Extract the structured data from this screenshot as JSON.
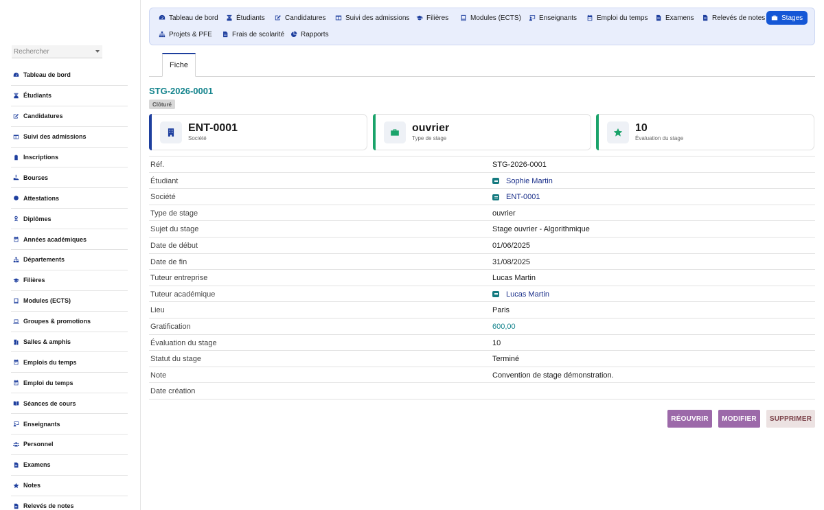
{
  "search": {
    "placeholder": "Rechercher"
  },
  "sidebar": {
    "items": [
      {
        "label": "Tableau de bord",
        "icon": "dashboard-icon"
      },
      {
        "label": "Étudiants",
        "icon": "student-icon"
      },
      {
        "label": "Candidatures",
        "icon": "pen-icon"
      },
      {
        "label": "Suivi des admissions",
        "icon": "columns-icon"
      },
      {
        "label": "Inscriptions",
        "icon": "clipboard-icon"
      },
      {
        "label": "Bourses",
        "icon": "hand-coin-icon"
      },
      {
        "label": "Attestations",
        "icon": "certificate-icon"
      },
      {
        "label": "Diplômes",
        "icon": "award-icon"
      },
      {
        "label": "Années académiques",
        "icon": "calendar-icon"
      },
      {
        "label": "Départements",
        "icon": "sitemap-icon"
      },
      {
        "label": "Filières",
        "icon": "graduation-cap-icon"
      },
      {
        "label": "Modules (ECTS)",
        "icon": "book-icon"
      },
      {
        "label": "Groupes & promotions",
        "icon": "laptop-icon"
      },
      {
        "label": "Salles & amphis",
        "icon": "door-icon"
      },
      {
        "label": "Emplois du temps",
        "icon": "calendar-icon"
      },
      {
        "label": "Emploi du temps",
        "icon": "calendar-icon"
      },
      {
        "label": "Séances de cours",
        "icon": "open-book-icon"
      },
      {
        "label": "Enseignants",
        "icon": "teacher-icon"
      },
      {
        "label": "Personnel",
        "icon": "users-icon"
      },
      {
        "label": "Examens",
        "icon": "file-icon"
      },
      {
        "label": "Notes",
        "icon": "star-icon"
      },
      {
        "label": "Relevés de notes",
        "icon": "file-icon"
      }
    ]
  },
  "topnav": {
    "items": [
      {
        "label": "Tableau de bord",
        "icon": "dashboard-icon"
      },
      {
        "label": "Étudiants",
        "icon": "student-icon"
      },
      {
        "label": "Candidatures",
        "icon": "pen-icon"
      },
      {
        "label": "Suivi des admissions",
        "icon": "columns-icon"
      },
      {
        "label": "Filières",
        "icon": "graduation-cap-icon"
      },
      {
        "label": "Modules (ECTS)",
        "icon": "book-icon"
      },
      {
        "label": "Enseignants",
        "icon": "teacher-icon"
      },
      {
        "label": "Emploi du temps",
        "icon": "calendar-icon"
      },
      {
        "label": "Examens",
        "icon": "file-icon"
      },
      {
        "label": "Relevés de notes",
        "icon": "file-icon"
      },
      {
        "label": "Stages",
        "icon": "briefcase-icon",
        "active": true
      },
      {
        "label": "Projets & PFE",
        "icon": "sitemap-icon"
      },
      {
        "label": "Frais de scolarité",
        "icon": "file-icon"
      },
      {
        "label": "Rapports",
        "icon": "pie-chart-icon"
      }
    ]
  },
  "tabs": {
    "fiche": "Fiche"
  },
  "record": {
    "id": "STG-2026-0001",
    "status": "Clôturé"
  },
  "cards": [
    {
      "value": "ENT-0001",
      "label": "Société",
      "icon": "building-icon",
      "accent": "#1e3f9e"
    },
    {
      "value": "ouvrier",
      "label": "Type de stage",
      "icon": "briefcase-icon",
      "accent": "#1aa36a"
    },
    {
      "value": "10",
      "label": "Évaluation du stage",
      "icon": "star-icon",
      "accent": "#1aa36a"
    }
  ],
  "details": [
    {
      "key": "Réf.",
      "value": "STG-2026-0001"
    },
    {
      "key": "Étudiant",
      "value": "Sophie Martin",
      "link": true
    },
    {
      "key": "Société",
      "value": "ENT-0001",
      "link": true
    },
    {
      "key": "Type de stage",
      "value": "ouvrier"
    },
    {
      "key": "Sujet du stage",
      "value": "Stage ouvrier - Algorithmique"
    },
    {
      "key": "Date de début",
      "value": "01/06/2025"
    },
    {
      "key": "Date de fin",
      "value": "31/08/2025"
    },
    {
      "key": "Tuteur entreprise",
      "value": "Lucas Martin"
    },
    {
      "key": "Tuteur académique",
      "value": "Lucas Martin",
      "link": true
    },
    {
      "key": "Lieu",
      "value": "Paris"
    },
    {
      "key": "Gratification",
      "value": "600,00",
      "money": true
    },
    {
      "key": "Évaluation du stage",
      "value": "10"
    },
    {
      "key": "Statut du stage",
      "value": "Terminé"
    },
    {
      "key": "Note",
      "value": "Convention de stage démonstration."
    },
    {
      "key": "Date création",
      "value": ""
    }
  ],
  "actions": {
    "reopen": "RÉOUVRIR",
    "edit": "MODIFIER",
    "delete": "SUPPRIMER"
  },
  "colors": {
    "primary": "#1557d6",
    "teal": "#13838c",
    "purple": "#9c69a9"
  }
}
